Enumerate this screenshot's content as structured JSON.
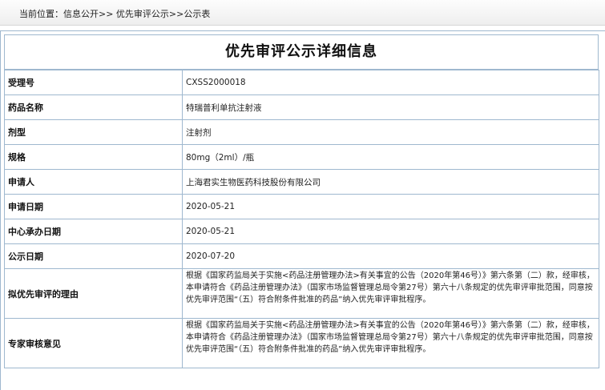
{
  "breadcrumb": {
    "text": "当前位置：信息公开>> 优先审评公示>>公示表"
  },
  "page": {
    "title": "优先审评公示详细信息"
  },
  "rows": [
    {
      "label": "受理号",
      "value": "CXSS2000018"
    },
    {
      "label": "药品名称",
      "value": "特瑞普利单抗注射液"
    },
    {
      "label": "剂型",
      "value": "注射剂"
    },
    {
      "label": "规格",
      "value": "80mg（2ml）/瓶"
    },
    {
      "label": "申请人",
      "value": "上海君实生物医药科技股份有限公司"
    },
    {
      "label": "申请日期",
      "value": "2020-05-21"
    },
    {
      "label": "中心承办日期",
      "value": "2020-05-21"
    },
    {
      "label": "公示日期",
      "value": "2020-07-20"
    },
    {
      "label": "拟优先审评的理由",
      "value": "根据《国家药监局关于实施<药品注册管理办法>有关事宜的公告（2020年第46号）》第六条第（二）款，经审核，本申请符合《药品注册管理办法》（国家市场监督管理总局令第27号）第六十八条规定的优先审评审批范围，同意按优先审评范围“（五）符合附条件批准的药品”纳入优先审评审批程序。"
    },
    {
      "label": "专家审核意见",
      "value": "根据《国家药监局关于实施<药品注册管理办法>有关事宜的公告（2020年第46号）》第六条第（二）款，经审核，本申请符合《药品注册管理办法》（国家市场监督管理总局令第27号）第六十八条规定的优先审评审批范围，同意按优先审评范围“（五）符合附条件批准的药品”纳入优先审评审批程序。"
    }
  ]
}
